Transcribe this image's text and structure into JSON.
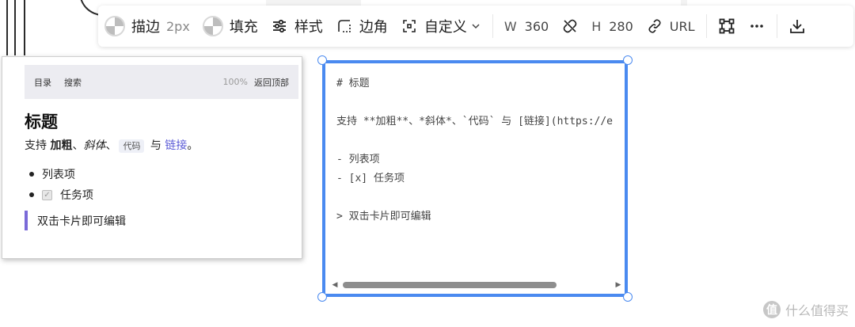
{
  "toolbar": {
    "stroke_label": "描边",
    "stroke_value": "2px",
    "fill_label": "填充",
    "style_label": "样式",
    "corner_label": "边角",
    "custom_label": "自定义",
    "width_label": "W",
    "width_value": "360",
    "height_label": "H",
    "height_value": "280",
    "url_label": "URL",
    "icons": [
      "checker-swatch-icon",
      "sliders-icon",
      "dashed-corner-icon",
      "dashed-frame-icon",
      "chevron-down-icon",
      "unlink-icon",
      "link-icon",
      "frame-icon",
      "more-icon",
      "download-icon"
    ]
  },
  "preview": {
    "nav_toc": "目录",
    "nav_search": "搜索",
    "nav_zoom": "100%",
    "nav_back_top": "返回顶部",
    "title": "标题",
    "para_prefix": "支持 ",
    "para_bold": "加粗",
    "para_sep1": "、",
    "para_italic": "斜体",
    "para_sep2": "、",
    "para_code": "代码",
    "para_and": " 与 ",
    "para_link": "链接",
    "para_end": "。",
    "list_item": "列表项",
    "task_item": "任务项",
    "quote": "双击卡片即可编辑"
  },
  "editor": {
    "lines": [
      "# 标题",
      "",
      "支持 **加粗**、*斜体*、`代码` 与 [链接](https://e",
      "",
      "- 列表项",
      "- [x] 任务项",
      "",
      "> 双击卡片即可编辑"
    ]
  },
  "watermark": {
    "logo_char": "值",
    "text": "什么值得买"
  },
  "colors": {
    "selection": "#4a8af0",
    "quote_bar": "#7a6ad8",
    "link": "#5b5bd6"
  }
}
